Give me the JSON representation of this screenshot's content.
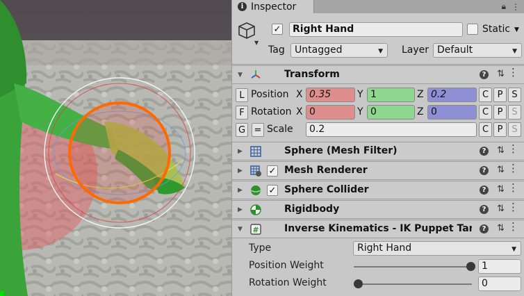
{
  "inspector": {
    "tab_label": "Inspector"
  },
  "gameobject": {
    "name": "Right Hand",
    "active": true,
    "static_label": "Static",
    "static_checked": false,
    "tag_label": "Tag",
    "tag_value": "Untagged",
    "layer_label": "Layer",
    "layer_value": "Default"
  },
  "transform": {
    "title": "Transform",
    "position": {
      "label": "Position",
      "btn": "L",
      "x": "0.35",
      "y": "1",
      "z": "0.2"
    },
    "rotation": {
      "label": "Rotation",
      "btn": "F",
      "x": "0",
      "y": "0",
      "z": "0"
    },
    "scale": {
      "label": "Scale",
      "btn": "G",
      "link_btn": "=",
      "value": "0.2"
    },
    "axis_labels": [
      "X",
      "Y",
      "Z"
    ],
    "copy_btn": "C",
    "paste_btn": "P",
    "s_btn": "S"
  },
  "components": [
    {
      "title": "Sphere (Mesh Filter)",
      "has_checkbox": false,
      "icon": "grid-icon"
    },
    {
      "title": "Mesh Renderer",
      "has_checkbox": true,
      "icon": "mesh-renderer-icon"
    },
    {
      "title": "Sphere Collider",
      "has_checkbox": true,
      "icon": "sphere-collider-icon"
    },
    {
      "title": "Rigidbody",
      "has_checkbox": false,
      "icon": "rigidbody-icon"
    },
    {
      "title": "Inverse Kinematics - IK Puppet Targ",
      "has_checkbox": false,
      "icon": "script-icon"
    }
  ],
  "ik": {
    "type_label": "Type",
    "type_value": "Right Hand",
    "position_weight_label": "Position Weight",
    "position_weight_value": "1",
    "position_weight": 1,
    "rotation_weight_label": "Rotation Weight",
    "rotation_weight_value": "0",
    "rotation_weight": 0
  },
  "colors": {
    "x_field": "#df8e8e",
    "y_field": "#8fd68f",
    "z_field": "#8f8fd6",
    "selection_outline": "#ff6a00",
    "avatar_green": "#3aa33a"
  }
}
